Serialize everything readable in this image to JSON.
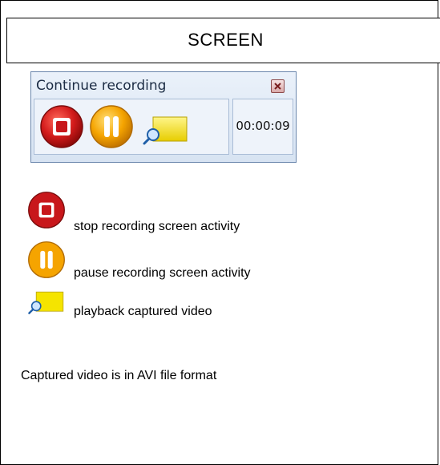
{
  "header": {
    "title": "SCREEN"
  },
  "widget": {
    "title": "Continue recording",
    "timer": "00:00:09",
    "icons": [
      "stop-icon",
      "pause-icon",
      "playback-icon",
      "close-icon"
    ]
  },
  "legend": {
    "stop": "stop recording screen activity",
    "pause": "pause recording screen activity",
    "playback": "playback captured video"
  },
  "note": "Captured video is in AVI file format",
  "colors": {
    "stop_red": "#c8171b",
    "pause_orange": "#f5a400",
    "playback_yellow": "#f5e400",
    "widget_border": "#6b87ad"
  }
}
